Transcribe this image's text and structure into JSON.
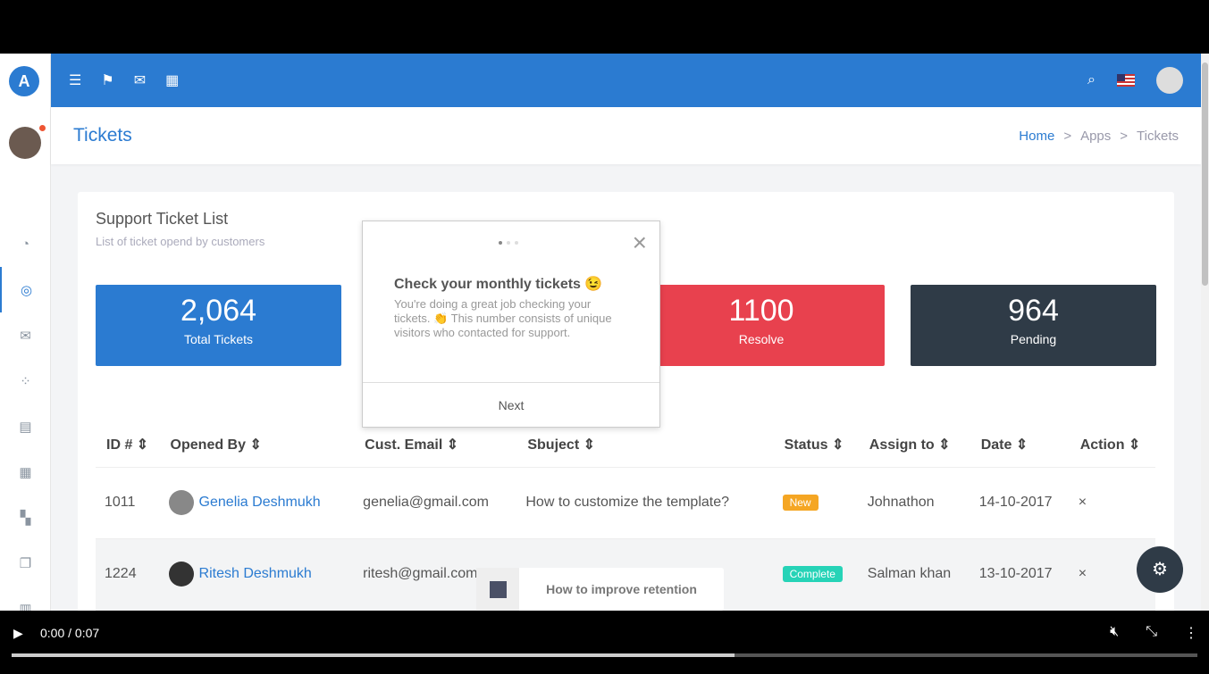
{
  "header": {
    "title": "Tickets",
    "breadcrumb": [
      "Home",
      "Apps",
      "Tickets"
    ]
  },
  "sidebar": {
    "icons": [
      "dashboard-icon",
      "target-icon",
      "mail-icon",
      "apps-icon",
      "file-icon",
      "table-icon",
      "widgets-icon",
      "copy-icon",
      "book-icon"
    ],
    "active": 1
  },
  "card": {
    "title": "Support Ticket List",
    "subtitle": "List of ticket opend by customers"
  },
  "stats": [
    {
      "value": "2,064",
      "label": "Total Tickets",
      "color": "#2b7bd1"
    },
    {
      "value": "1100",
      "label": "Resolve",
      "color": "#e8414e"
    },
    {
      "value": "964",
      "label": "Pending",
      "color": "#2f3b47"
    }
  ],
  "table": {
    "columns": [
      "ID #",
      "Opened By",
      "Cust. Email",
      "Sbuject",
      "Status",
      "Assign to",
      "Date",
      "Action"
    ],
    "rows": [
      {
        "id": "1011",
        "name": "Genelia Deshmukh",
        "email": "genelia@gmail.com",
        "subject": "How to customize the template?",
        "status": "New",
        "status_color": "#f5a623",
        "assign": "Johnathon",
        "date": "14-10-2017",
        "action": "×"
      },
      {
        "id": "1224",
        "name": "Ritesh Deshmukh",
        "email": "ritesh@gmail.com",
        "subject": "",
        "status": "Complete",
        "status_color": "#26d3b7",
        "assign": "Salman khan",
        "date": "13-10-2017",
        "action": "×"
      }
    ]
  },
  "popup": {
    "title": "Check your monthly tickets 😉",
    "text": "You're doing a great job checking your tickets. 👏 This number consists of unique visitors who contacted for support.",
    "next": "Next",
    "close": "×",
    "step": 1,
    "steps": 3
  },
  "retention": {
    "label": "How to improve retention"
  },
  "video": {
    "time": "0:00 / 0:07",
    "progress_percent": 61
  }
}
